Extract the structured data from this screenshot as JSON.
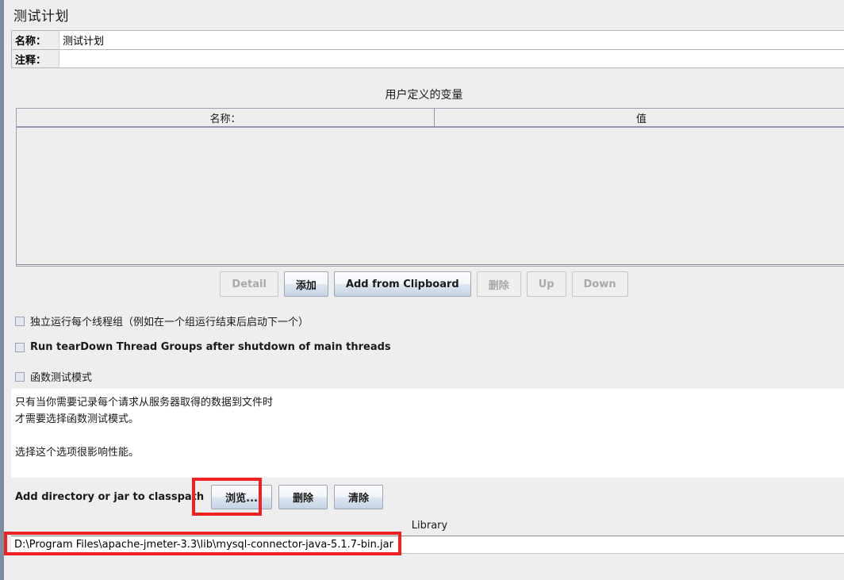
{
  "panel": {
    "title": "测试计划"
  },
  "fields": {
    "name_label": "名称：",
    "name_value": "测试计划",
    "comment_label": "注释：",
    "comment_value": ""
  },
  "user_variables": {
    "caption": "用户定义的变量",
    "columns": [
      "名称：",
      "值"
    ],
    "rows": []
  },
  "variable_buttons": [
    {
      "label": "Detail",
      "enabled": false
    },
    {
      "label": "添加",
      "enabled": true
    },
    {
      "label": "Add from Clipboard",
      "enabled": true
    },
    {
      "label": "删除",
      "enabled": false
    },
    {
      "label": "Up",
      "enabled": false
    },
    {
      "label": "Down",
      "enabled": false
    }
  ],
  "checkboxes": [
    {
      "label": "独立运行每个线程组（例如在一个组运行结束后启动下一个）",
      "checked": false,
      "bold": false
    },
    {
      "label": "Run tearDown Thread Groups after shutdown of main threads",
      "checked": false,
      "bold": true
    },
    {
      "label": "函数测试模式",
      "checked": false,
      "bold": false
    }
  ],
  "description": {
    "line1": "只有当你需要记录每个请求从服务器取得的数据到文件时",
    "line2": "才需要选择函数测试模式。",
    "line3": "选择这个选项很影响性能。"
  },
  "classpath": {
    "label": "Add directory or jar to classpath",
    "buttons": [
      {
        "label": "浏览...",
        "enabled": true
      },
      {
        "label": "删除",
        "enabled": true
      },
      {
        "label": "清除",
        "enabled": true
      }
    ]
  },
  "library_table": {
    "header": "Library",
    "rows": [
      "D:\\Program Files\\apache-jmeter-3.3\\lib\\mysql-connector-java-5.1.7-bin.jar"
    ]
  },
  "annotations": {
    "highlight_color": "#ee2222",
    "boxes": [
      "browse-button",
      "library-path-row"
    ]
  }
}
